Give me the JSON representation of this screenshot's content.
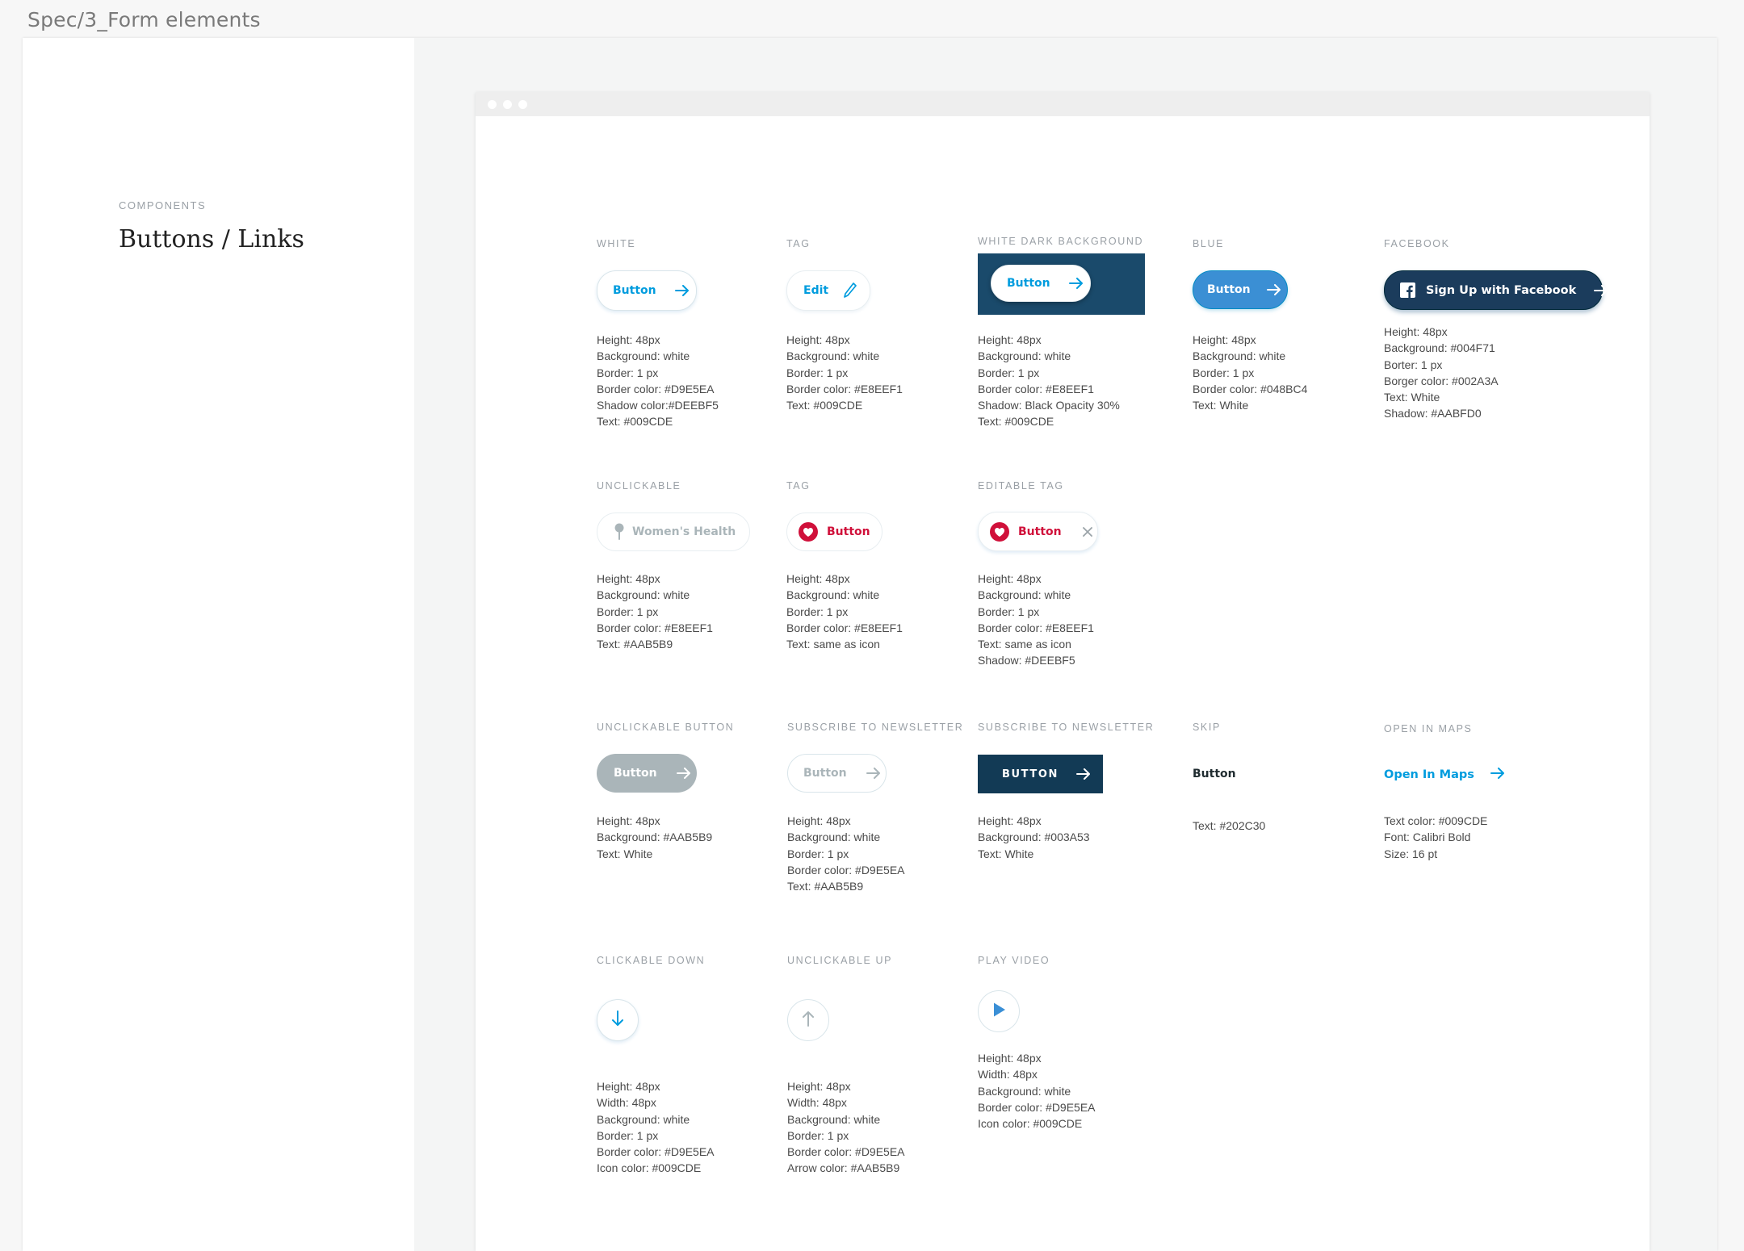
{
  "page_title": "Spec/3_Form elements",
  "sidebar": {
    "category": "COMPONENTS",
    "title": "Buttons / Links"
  },
  "colors": {
    "primary_text": "#009CDE",
    "muted": "#AAB5B9",
    "border": "#D9E5EA",
    "border_light": "#E8EEF1",
    "dark_navy": "#003A53",
    "facebook": "#004F71",
    "blue": "#048BC4",
    "heart": "#D0103A",
    "skip_text": "#202C30"
  },
  "icons": [
    "arrow-right-icon",
    "pencil-icon",
    "facebook-icon",
    "pin-icon",
    "heart-icon",
    "close-icon",
    "arrow-down-icon",
    "arrow-up-icon",
    "play-icon"
  ],
  "sections": {
    "white": {
      "label": "WHITE",
      "button": "Button",
      "specs": [
        "Height: 48px",
        "Background: white",
        "Border: 1 px",
        "Border color: #D9E5EA",
        "Shadow color:#DEEBF5",
        "Text: #009CDE"
      ]
    },
    "tag": {
      "label": "TAG",
      "button": "Edit",
      "specs": [
        "Height: 48px",
        "Background: white",
        "Border: 1 px",
        "Border color: #E8EEF1",
        "Text: #009CDE"
      ]
    },
    "white_dark": {
      "label": "WHITE DARK BACKGROUND",
      "button": "Button",
      "specs": [
        "Height: 48px",
        "Background: white",
        "Border: 1 px",
        "Border color: #E8EEF1",
        "Shadow: Black Opacity 30%",
        "Text: #009CDE"
      ]
    },
    "blue": {
      "label": "BLUE",
      "button": "Button",
      "specs": [
        "Height: 48px",
        "Background: white",
        "Border: 1 px",
        "Border color: #048BC4",
        "Text: White"
      ]
    },
    "facebook": {
      "label": "FACEBOOK",
      "button": "Sign Up with Facebook",
      "specs": [
        "Height: 48px",
        "Background: #004F71",
        "Borter: 1 px",
        "Borger color: #002A3A",
        "Text: White",
        "Shadow: #AABFD0"
      ]
    },
    "unclickable": {
      "label": "UNCLICKABLE",
      "button": "Women's Health",
      "specs": [
        "Height: 48px",
        "Background: white",
        "Border: 1 px",
        "Border color: #E8EEF1",
        "Text: #AAB5B9"
      ]
    },
    "tag2": {
      "label": "TAG",
      "button": "Button",
      "specs": [
        "Height: 48px",
        "Background: white",
        "Border: 1 px",
        "Border color: #E8EEF1",
        "Text: same as icon"
      ]
    },
    "editable_tag": {
      "label": "EDITABLE TAG",
      "button": "Button",
      "specs": [
        "Height: 48px",
        "Background: white",
        "Border: 1 px",
        "Border color: #E8EEF1",
        "Text: same as icon",
        "Shadow: #DEEBF5"
      ]
    },
    "unclickable_button": {
      "label": "UNCLICKABLE BUTTON",
      "button": "Button",
      "specs": [
        "Height: 48px",
        "Background: #AAB5B9",
        "Text: White"
      ]
    },
    "subscribe1": {
      "label": "SUBSCRIBE TO NEWSLETTER",
      "button": "Button",
      "specs": [
        "Height: 48px",
        "Background: white",
        "Border: 1 px",
        "Border color: #D9E5EA",
        "Text: #AAB5B9"
      ]
    },
    "subscribe2": {
      "label": "SUBSCRIBE TO NEWSLETTER",
      "button": "BUTTON",
      "specs": [
        "Height: 48px",
        "Background: #003A53",
        "Text: White"
      ]
    },
    "skip": {
      "label": "SKIP",
      "button": "Button",
      "specs": [
        "Text: #202C30"
      ]
    },
    "open_maps": {
      "label": "OPEN IN MAPS",
      "button": "Open In Maps",
      "specs": [
        "Text color: #009CDE",
        "Font: Calibri Bold",
        "Size: 16 pt"
      ]
    },
    "clickable_down": {
      "label": "CLICKABLE DOWN",
      "specs": [
        "Height: 48px",
        "Width: 48px",
        "Background: white",
        "Border: 1 px",
        "Border color: #D9E5EA",
        "Icon color: #009CDE"
      ]
    },
    "unclickable_up": {
      "label": "UNCLICKABLE UP",
      "specs": [
        "Height: 48px",
        "Width: 48px",
        "Background: white",
        "Border: 1 px",
        "Border color: #D9E5EA",
        "Arrow color: #AAB5B9"
      ]
    },
    "play_video": {
      "label": "PLAY VIDEO",
      "specs": [
        "Height: 48px",
        "Width: 48px",
        "Background: white",
        "Border color: #D9E5EA",
        "Icon color: #009CDE"
      ]
    }
  }
}
